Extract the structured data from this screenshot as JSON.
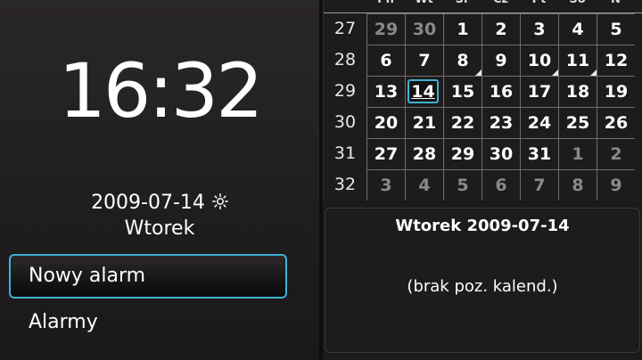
{
  "clock": {
    "time": "16:32"
  },
  "date": {
    "text": "2009-07-14",
    "weather_icon": "sun-icon",
    "weekday": "Wtorek"
  },
  "menu": {
    "new_alarm": "Nowy alarm",
    "alarms": "Alarmy"
  },
  "calendar": {
    "day_headers": [
      "Pn",
      "Wt",
      "Śr",
      "Cz",
      "Pt",
      "So",
      "N"
    ],
    "weeks": [
      {
        "week": "27",
        "days": [
          {
            "d": "29",
            "dim": true
          },
          {
            "d": "30",
            "dim": true
          },
          {
            "d": "1"
          },
          {
            "d": "2"
          },
          {
            "d": "3"
          },
          {
            "d": "4"
          },
          {
            "d": "5"
          }
        ]
      },
      {
        "week": "28",
        "days": [
          {
            "d": "6"
          },
          {
            "d": "7"
          },
          {
            "d": "8",
            "marked": true
          },
          {
            "d": "9"
          },
          {
            "d": "10",
            "marked": true
          },
          {
            "d": "11",
            "marked": true
          },
          {
            "d": "12"
          }
        ]
      },
      {
        "week": "29",
        "days": [
          {
            "d": "13"
          },
          {
            "d": "14",
            "today": true
          },
          {
            "d": "15"
          },
          {
            "d": "16"
          },
          {
            "d": "17"
          },
          {
            "d": "18"
          },
          {
            "d": "19"
          }
        ]
      },
      {
        "week": "30",
        "days": [
          {
            "d": "20"
          },
          {
            "d": "21"
          },
          {
            "d": "22"
          },
          {
            "d": "23"
          },
          {
            "d": "24"
          },
          {
            "d": "25"
          },
          {
            "d": "26"
          }
        ]
      },
      {
        "week": "31",
        "days": [
          {
            "d": "27"
          },
          {
            "d": "28"
          },
          {
            "d": "29"
          },
          {
            "d": "30"
          },
          {
            "d": "31"
          },
          {
            "d": "1",
            "dim": true
          },
          {
            "d": "2",
            "dim": true
          }
        ]
      },
      {
        "week": "32",
        "days": [
          {
            "d": "3",
            "dim": true
          },
          {
            "d": "4",
            "dim": true
          },
          {
            "d": "5",
            "dim": true
          },
          {
            "d": "6",
            "dim": true
          },
          {
            "d": "7",
            "dim": true
          },
          {
            "d": "8",
            "dim": true
          },
          {
            "d": "9",
            "dim": true
          }
        ]
      }
    ]
  },
  "agenda": {
    "title": "Wtorek 2009-07-14",
    "empty_text": "(brak poz. kalend.)"
  },
  "colors": {
    "accent": "#3fb2d4",
    "background": "#1c1a1b",
    "dim_text": "#8a8889"
  }
}
